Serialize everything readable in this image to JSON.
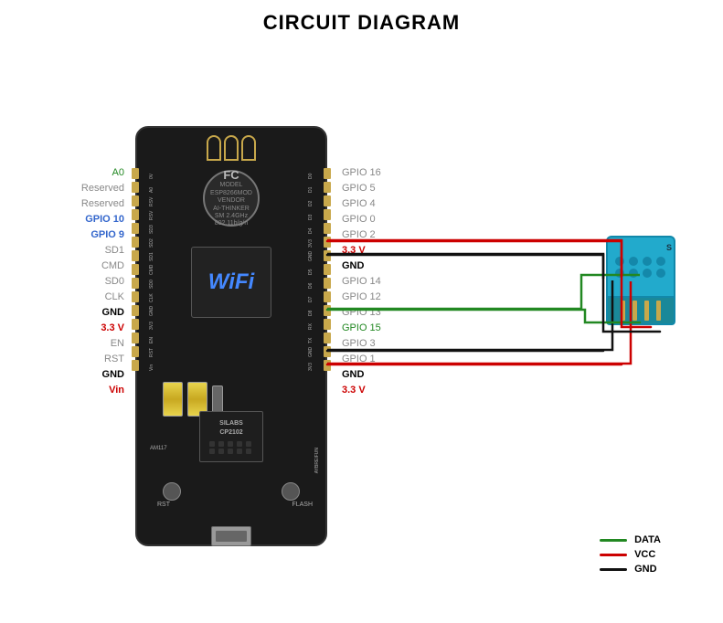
{
  "title": "CIRCUIT DIAGRAM",
  "left_labels": [
    {
      "text": "A0",
      "color": "green"
    },
    {
      "text": "Reserved",
      "color": "gray"
    },
    {
      "text": "Reserved",
      "color": "gray"
    },
    {
      "text": "GPIO 10",
      "color": "blue"
    },
    {
      "text": "GPIO 9",
      "color": "blue"
    },
    {
      "text": "SD1",
      "color": "gray"
    },
    {
      "text": "CMD",
      "color": "gray"
    },
    {
      "text": "SD0",
      "color": "gray"
    },
    {
      "text": "CLK",
      "color": "gray"
    },
    {
      "text": "GND",
      "color": "black"
    },
    {
      "text": "3.3 V",
      "color": "red"
    },
    {
      "text": "EN",
      "color": "gray"
    },
    {
      "text": "RST",
      "color": "gray"
    },
    {
      "text": "GND",
      "color": "black"
    },
    {
      "text": "Vin",
      "color": "red"
    }
  ],
  "right_labels": [
    {
      "text": "GPIO 16",
      "color": "gray"
    },
    {
      "text": "GPIO 5",
      "color": "gray"
    },
    {
      "text": "GPIO 4",
      "color": "gray"
    },
    {
      "text": "GPIO 0",
      "color": "gray"
    },
    {
      "text": "GPIO 2",
      "color": "gray"
    },
    {
      "text": "3.3 V",
      "color": "red"
    },
    {
      "text": "GND",
      "color": "black"
    },
    {
      "text": "GPIO 14",
      "color": "gray"
    },
    {
      "text": "GPIO 12",
      "color": "gray"
    },
    {
      "text": "GPIO 13",
      "color": "gray"
    },
    {
      "text": "GPIO 15",
      "color": "green"
    },
    {
      "text": "GPIO 3",
      "color": "gray"
    },
    {
      "text": "GPIO 1",
      "color": "gray"
    },
    {
      "text": "GND",
      "color": "black"
    },
    {
      "text": "3.3 V",
      "color": "red"
    }
  ],
  "legend": [
    {
      "label": "DATA",
      "color": "#228822"
    },
    {
      "label": "VCC",
      "color": "#cc0000"
    },
    {
      "label": "GND",
      "color": "#000000"
    }
  ],
  "board": {
    "wifi_text": "WiFi",
    "fc_text": "FC",
    "chip_text": "SILABS\nCP2102"
  }
}
